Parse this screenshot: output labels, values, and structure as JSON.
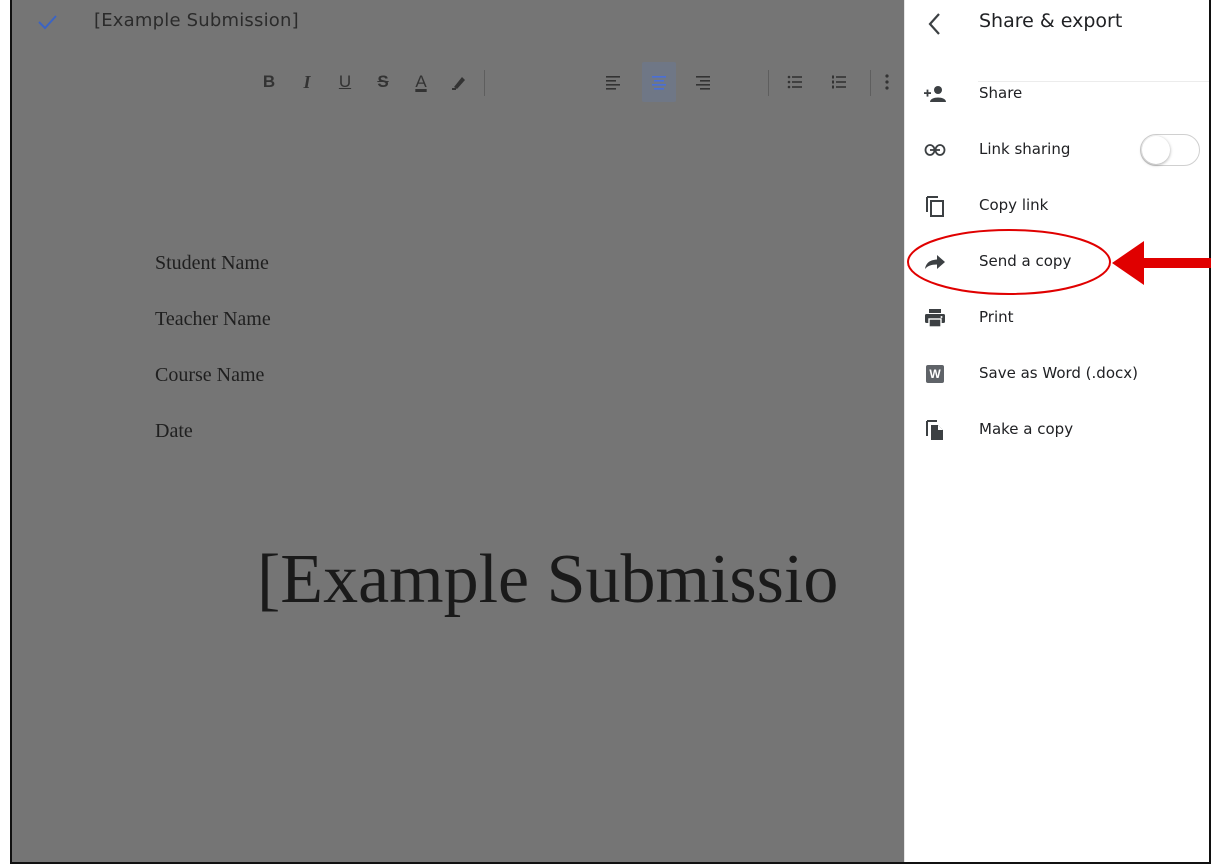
{
  "document": {
    "title": "[Example Submission]",
    "toolbar": {
      "buttons": [
        {
          "name": "bold",
          "glyph": "B"
        },
        {
          "name": "italic",
          "glyph": "I"
        },
        {
          "name": "underline",
          "glyph": "U"
        },
        {
          "name": "strikethrough",
          "glyph": "S"
        },
        {
          "name": "text-color",
          "glyph": "A"
        }
      ]
    },
    "lines": [
      "Student Name",
      "Teacher Name",
      "Course Name",
      "Date"
    ],
    "heading": "[Example Submissio"
  },
  "panel": {
    "title": "Share & export",
    "items": [
      {
        "label": "Share",
        "icon": "add-person-icon"
      },
      {
        "label": "Link sharing",
        "icon": "link-icon",
        "toggle": false
      },
      {
        "label": "Copy link",
        "icon": "copy-icon"
      },
      {
        "label": "Send a copy",
        "icon": "forward-arrow-icon",
        "highlighted": true
      },
      {
        "label": "Print",
        "icon": "printer-icon"
      },
      {
        "label": "Save as Word (.docx)",
        "icon": "word-icon",
        "badge": "W"
      },
      {
        "label": "Make a copy",
        "icon": "file-copy-icon"
      }
    ]
  },
  "colors": {
    "overlay": "#757575",
    "annotation": "#e00000",
    "accent": "#4a6fd8"
  }
}
